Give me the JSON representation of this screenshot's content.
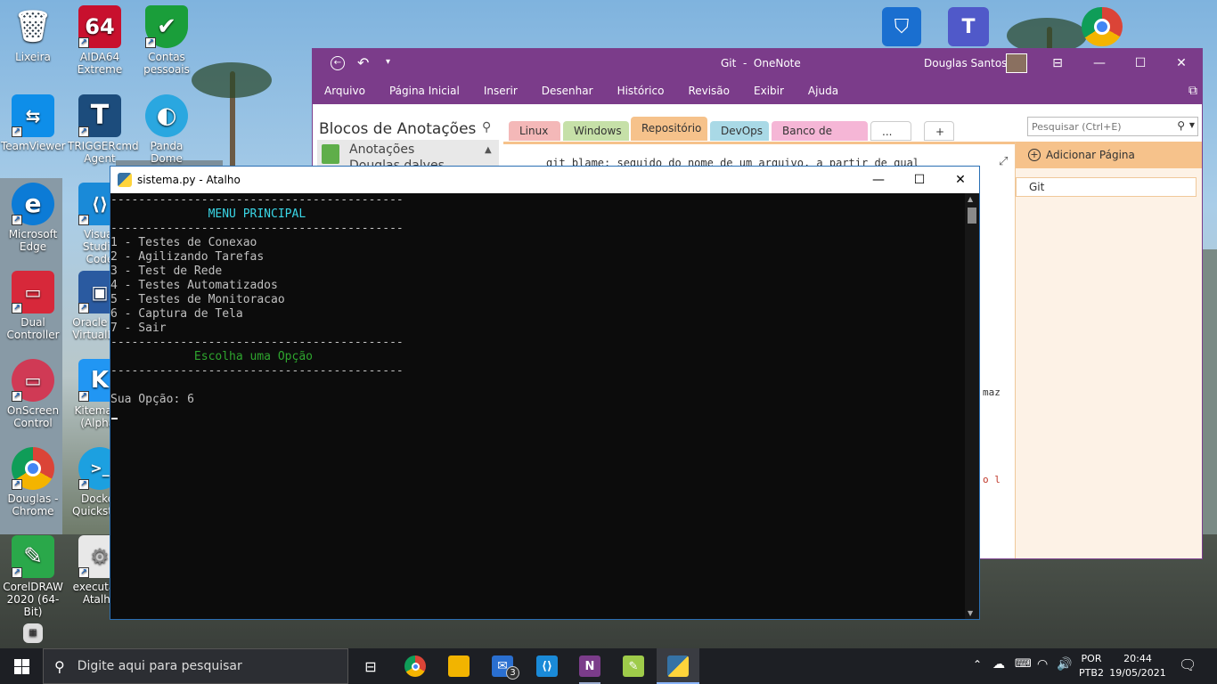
{
  "desktop": {
    "icons": [
      {
        "label": "Lixeira",
        "glyph": "🗑",
        "color": "#b8c8d8"
      },
      {
        "label": "AIDA64 Extreme",
        "glyph": "64",
        "color": "#c8102e"
      },
      {
        "label": "Contas pessoais",
        "glyph": "✔",
        "color": "#1a9e3a"
      },
      {
        "label": "TeamViewer",
        "glyph": "⇆",
        "color": "#0e8ee9"
      },
      {
        "label": "TRIGGERcmd Agent",
        "glyph": "T",
        "color": "#1c4c7c"
      },
      {
        "label": "Panda Dome",
        "glyph": "◐",
        "color": "#2aa7e0"
      },
      {
        "label": "Microsoft Edge",
        "glyph": "e",
        "color": "#0c7bd6"
      },
      {
        "label": "Visual Studio Code",
        "glyph": "⟨⟩",
        "color": "#1a8ad8"
      },
      {
        "label": "Dual Controller",
        "glyph": "▭",
        "color": "#d7283a"
      },
      {
        "label": "Oracle VM VirtualBox",
        "glyph": "▣",
        "color": "#2a5aa0"
      },
      {
        "label": "OnScreen Control",
        "glyph": "▭",
        "color": "#d03a55"
      },
      {
        "label": "Kitematic (Alpha)",
        "glyph": "K",
        "color": "#2196f3"
      },
      {
        "label": "Douglas - Chrome",
        "glyph": "◉",
        "color": "#e0a800"
      },
      {
        "label": "Docker Quickstart",
        "glyph": ">_",
        "color": "#1ca0e0"
      },
      {
        "label": "CorelDRAW 2020 (64-Bit)",
        "glyph": "✎",
        "color": "#2aa84a"
      },
      {
        "label": "executar - Atalho",
        "glyph": "⚙",
        "color": "#e8e8e8"
      }
    ]
  },
  "onenote": {
    "window_title": "Git  -  OneNote",
    "user": "Douglas Santos",
    "menu": [
      "Arquivo",
      "Página Inicial",
      "Inserir",
      "Desenhar",
      "Histórico",
      "Revisão",
      "Exibir",
      "Ajuda"
    ],
    "notebooks_title": "Blocos de Anotações",
    "notebook_item": "Anotações",
    "notebook_sub": "Douglas dalves",
    "section_tabs": [
      {
        "label": "Linux",
        "color": "#f4b8b8"
      },
      {
        "label": "Windows",
        "color": "#c6e0a8"
      },
      {
        "label": "Repositório",
        "color": "#f6c28b"
      },
      {
        "label": "DevOps",
        "color": "#a9d9e6"
      },
      {
        "label": "Banco de dados",
        "color": "#f5b6d6"
      },
      {
        "label": "...",
        "color": "#ffffff"
      }
    ],
    "search_placeholder": "Pesquisar (Ctrl+E)",
    "add_page": "Adicionar Página",
    "pages": [
      "Git"
    ],
    "note_text": "git blame: seguido do nome de um arquivo, a partir de qual",
    "note_fragment_1": "maz",
    "note_fragment_2": "o l"
  },
  "console": {
    "title": "sistema.py - Atalho",
    "lines": [
      {
        "text": "------------------------------------------",
        "color": "#c0c0c0"
      },
      {
        "text": "              MENU PRINCIPAL",
        "color": "#3ad6e6"
      },
      {
        "text": "------------------------------------------",
        "color": "#c0c0c0"
      },
      {
        "text": "1 - Testes de Conexao",
        "color": "#c0c0c0"
      },
      {
        "text": "2 - Agilizando Tarefas",
        "color": "#c0c0c0"
      },
      {
        "text": "3 - Test de Rede",
        "color": "#c0c0c0"
      },
      {
        "text": "4 - Testes Automatizados",
        "color": "#c0c0c0"
      },
      {
        "text": "5 - Testes de Monitoracao",
        "color": "#c0c0c0"
      },
      {
        "text": "6 - Captura de Tela",
        "color": "#c0c0c0"
      },
      {
        "text": "7 - Sair",
        "color": "#c0c0c0"
      },
      {
        "text": "------------------------------------------",
        "color": "#c0c0c0"
      },
      {
        "text": "            Escolha uma Opção",
        "color": "#2ea52e"
      },
      {
        "text": "------------------------------------------",
        "color": "#c0c0c0"
      },
      {
        "text": "",
        "color": "#c0c0c0"
      },
      {
        "text": "Sua Opção: 6",
        "color": "#c0c0c0"
      }
    ]
  },
  "taskbar": {
    "search_placeholder": "Digite aqui para pesquisar",
    "mail_badge": "3",
    "language": "POR",
    "layout": "PTB2",
    "time": "20:44",
    "date": "19/05/2021"
  }
}
